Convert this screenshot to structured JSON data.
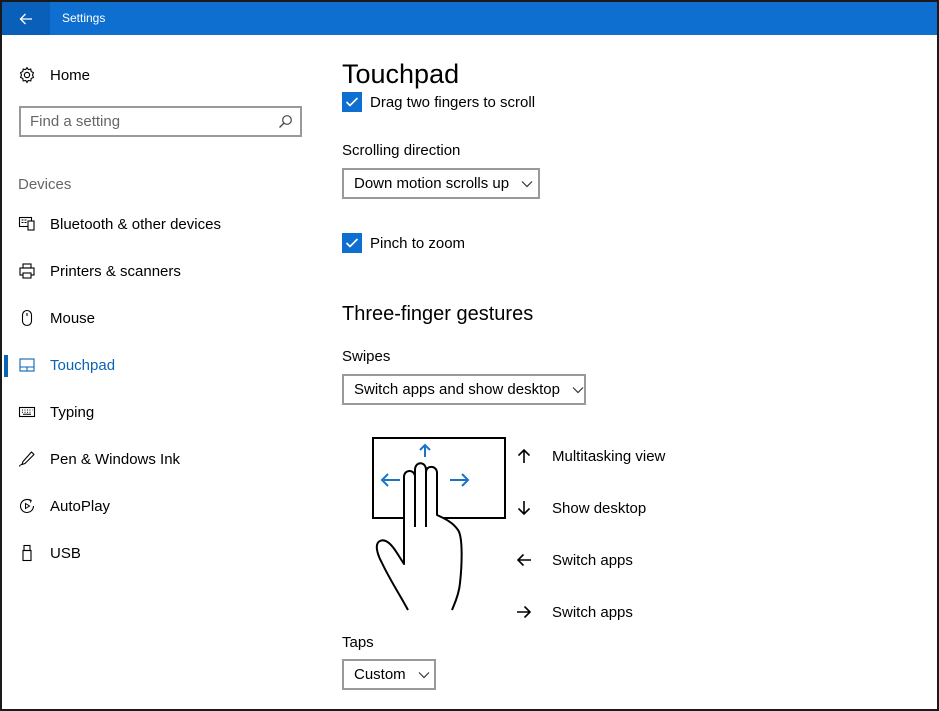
{
  "window": {
    "title": "Settings"
  },
  "sidebar": {
    "home_label": "Home",
    "search_placeholder": "Find a setting",
    "section_label": "Devices",
    "items": [
      {
        "label": "Bluetooth & other devices",
        "icon": "bluetooth-devices-icon"
      },
      {
        "label": "Printers & scanners",
        "icon": "printer-icon"
      },
      {
        "label": "Mouse",
        "icon": "mouse-icon"
      },
      {
        "label": "Touchpad",
        "icon": "touchpad-icon",
        "selected": true
      },
      {
        "label": "Typing",
        "icon": "keyboard-icon"
      },
      {
        "label": "Pen & Windows Ink",
        "icon": "pen-icon"
      },
      {
        "label": "AutoPlay",
        "icon": "autoplay-icon"
      },
      {
        "label": "USB",
        "icon": "usb-icon"
      }
    ]
  },
  "main": {
    "title": "Touchpad",
    "drag_two_fingers": {
      "label": "Drag two fingers to scroll",
      "checked": true
    },
    "scrolling_direction": {
      "label": "Scrolling direction",
      "value": "Down motion scrolls up"
    },
    "pinch_to_zoom": {
      "label": "Pinch to zoom",
      "checked": true
    },
    "three_finger_heading": "Three-finger gestures",
    "swipes": {
      "label": "Swipes",
      "value": "Switch apps and show desktop"
    },
    "gestures": [
      {
        "direction": "up",
        "label": "Multitasking view"
      },
      {
        "direction": "down",
        "label": "Show desktop"
      },
      {
        "direction": "left",
        "label": "Switch apps"
      },
      {
        "direction": "right",
        "label": "Switch apps"
      }
    ],
    "taps": {
      "label": "Taps",
      "value": "Custom"
    }
  },
  "colors": {
    "accent": "#0a64b4",
    "titlebar": "#0e6fd1",
    "back_button": "#0a5fb8",
    "checkbox": "#0e6fd1"
  }
}
